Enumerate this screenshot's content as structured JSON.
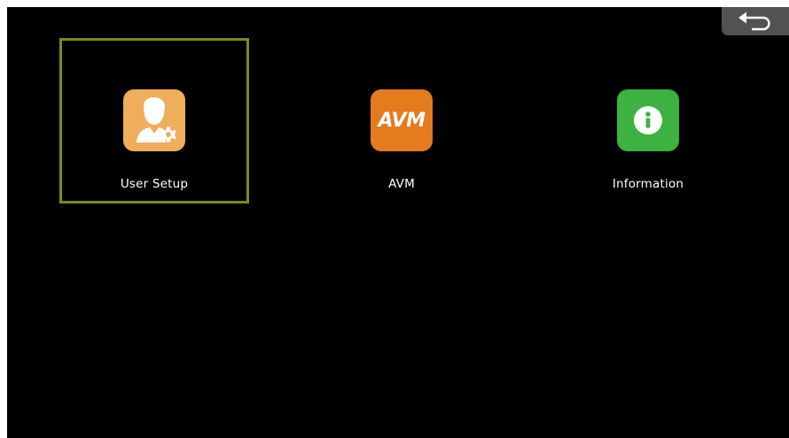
{
  "menu": {
    "items": [
      {
        "id": "user-setup",
        "label": "User Setup",
        "icon": "user-settings-icon",
        "tile_color": "#f0ad5b",
        "selected": true
      },
      {
        "id": "avm",
        "label": "AVM",
        "icon_text": "AVM",
        "icon": "avm-icon",
        "tile_color": "#e47b1d",
        "selected": false
      },
      {
        "id": "information",
        "label": "Information",
        "icon": "info-icon",
        "tile_color": "#3db240",
        "selected": false
      }
    ]
  },
  "back_button": {
    "icon": "back-arrow-icon"
  },
  "colors": {
    "background": "#000000",
    "selection_border": "#7f8a17",
    "back_button_bg": "#525252"
  }
}
